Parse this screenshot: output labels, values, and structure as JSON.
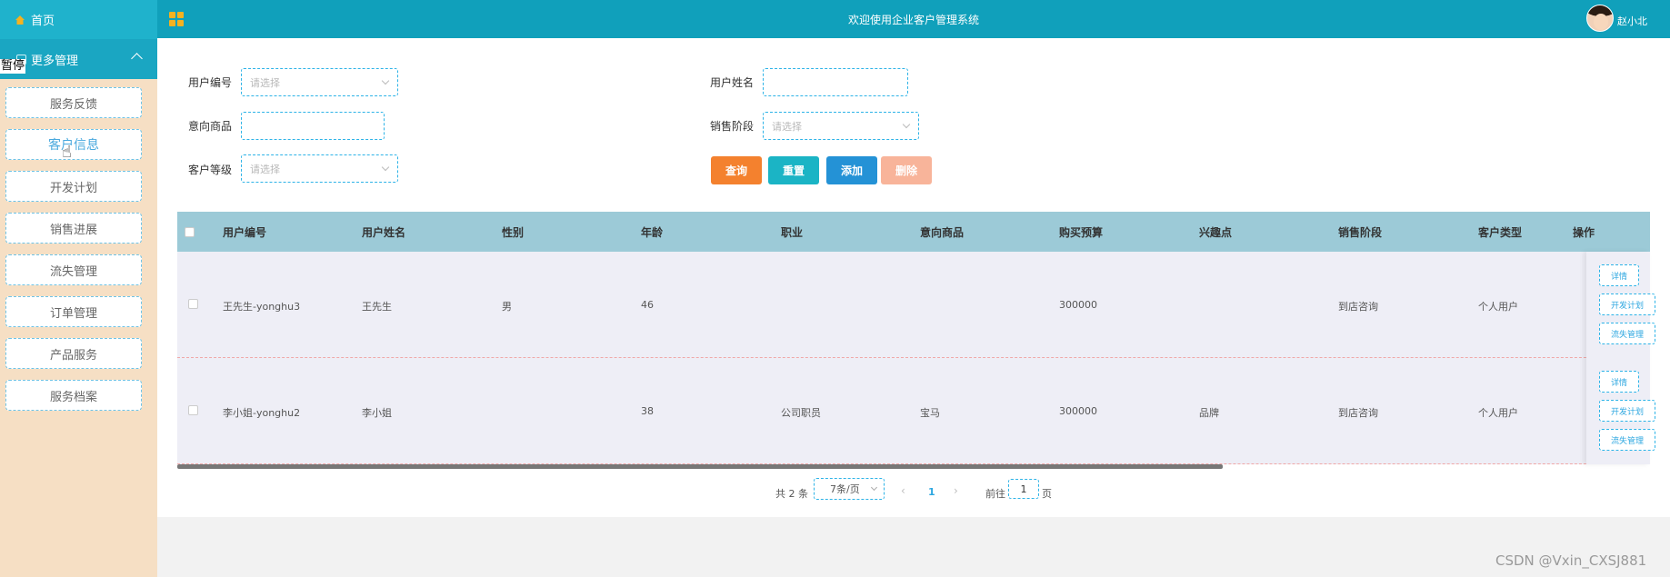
{
  "sidebar": {
    "home_label": "首页",
    "more_label": "更多管理",
    "pause_label": "暂停",
    "items": [
      {
        "label": "服务反馈"
      },
      {
        "label": "客户信息"
      },
      {
        "label": "开发计划"
      },
      {
        "label": "销售进展"
      },
      {
        "label": "流失管理"
      },
      {
        "label": "订单管理"
      },
      {
        "label": "产品服务"
      },
      {
        "label": "服务档案"
      }
    ],
    "active_item": "客户信息"
  },
  "header": {
    "title": "欢迎使用企业客户管理系统",
    "user_name": "赵小北"
  },
  "filters": {
    "user_id_label": "用户编号",
    "user_id_placeholder": "请选择",
    "user_name_label": "用户姓名",
    "user_name_value": "",
    "product_label": "意向商品",
    "product_value": "",
    "stage_label": "销售阶段",
    "stage_placeholder": "请选择",
    "level_label": "客户等级",
    "level_placeholder": "请选择"
  },
  "actions": {
    "query": "查询",
    "reset": "重置",
    "add": "添加",
    "delete": "删除"
  },
  "colors": {
    "query": "#f4812e",
    "reset": "#1bb4c5",
    "add": "#2492d6",
    "delete": "#f8b49a",
    "header": "#10a0bb",
    "table_head": "#9ccad7"
  },
  "table": {
    "columns": [
      "用户编号",
      "用户姓名",
      "性别",
      "年龄",
      "职业",
      "意向商品",
      "购买预算",
      "兴趣点",
      "销售阶段",
      "客户类型",
      "操作"
    ],
    "rows": [
      {
        "user_id": "王先生-yonghu3",
        "name": "王先生",
        "gender": "男",
        "age": "46",
        "job": "",
        "product": "",
        "budget": "300000",
        "interest": "",
        "stage": "到店咨询",
        "type": "个人用户"
      },
      {
        "user_id": "李小姐-yonghu2",
        "name": "李小姐",
        "gender": "",
        "age": "38",
        "job": "公司职员",
        "product": "宝马",
        "budget": "300000",
        "interest": "品牌",
        "stage": "到店咨询",
        "type": "个人用户"
      }
    ],
    "row_actions": [
      "详情",
      "开发计划",
      "流失管理"
    ]
  },
  "pagination": {
    "total": "共 2 条",
    "page_size": "7条/页",
    "prev": "‹",
    "current": "1",
    "next": "›",
    "goto_label": "前往",
    "goto_value": "1",
    "page_suffix": "页"
  },
  "watermark": "CSDN @Vxin_CXSJ881"
}
